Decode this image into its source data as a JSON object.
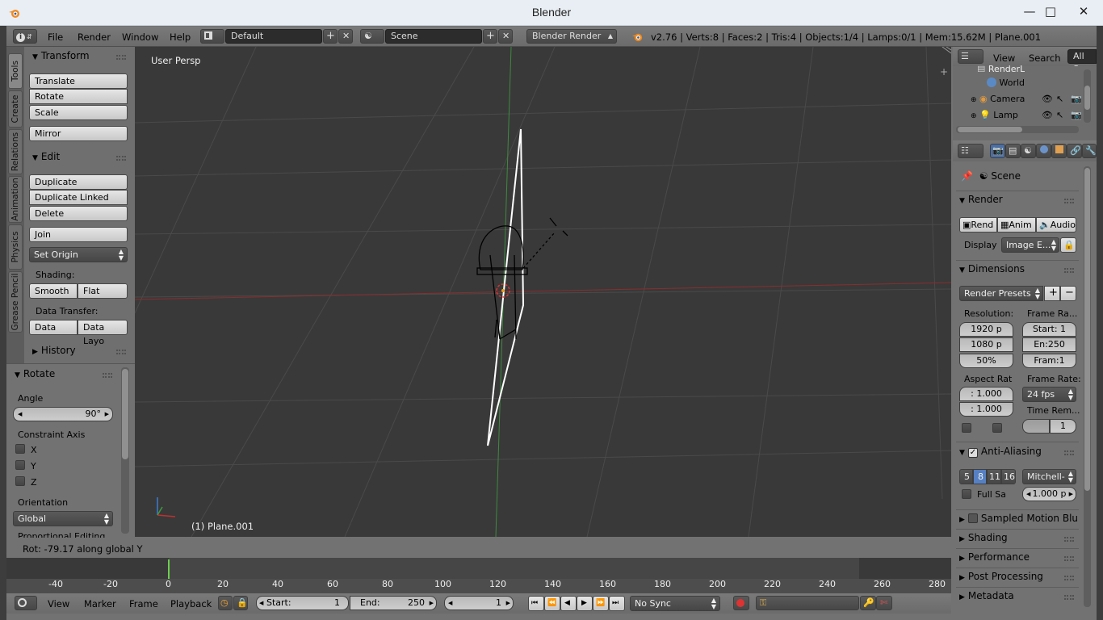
{
  "window": {
    "title": "Blender"
  },
  "info_header": {
    "menus": [
      "File",
      "Render",
      "Window",
      "Help"
    ],
    "layout": "Default",
    "scene": "Scene",
    "engine": "Blender Render",
    "stats": "v2.76 | Verts:8 | Faces:2 | Tris:4 | Objects:1/4 | Lamps:0/1 | Mem:15.62M | Plane.001"
  },
  "shelf": {
    "tabs": [
      "Tools",
      "Create",
      "Relations",
      "Animation",
      "Physics",
      "Grease Pencil"
    ],
    "transform": {
      "title": "Transform",
      "translate": "Translate",
      "rotate": "Rotate",
      "scale": "Scale",
      "mirror": "Mirror"
    },
    "edit": {
      "title": "Edit",
      "duplicate": "Duplicate",
      "duplicate_linked": "Duplicate Linked",
      "delete": "Delete",
      "join": "Join",
      "set_origin": "Set Origin",
      "shading_label": "Shading:",
      "smooth": "Smooth",
      "flat": "Flat",
      "data_transfer_label": "Data Transfer:",
      "data": "Data",
      "data_layo": "Data Layo"
    },
    "history": {
      "title": "History"
    }
  },
  "redo": {
    "title": "Rotate",
    "angle_label": "Angle",
    "angle": "90°",
    "constraint_label": "Constraint Axis",
    "axes": [
      "X",
      "Y",
      "Z"
    ],
    "orientation_label": "Orientation",
    "orientation": "Global",
    "proportional": "Proportional Editing"
  },
  "viewport": {
    "view_name": "User Persp",
    "object_label": "(1) Plane.001"
  },
  "status": {
    "text": "Rot: -79.17 along global Y"
  },
  "timeline": {
    "ticks": [
      "-40",
      "-20",
      "0",
      "20",
      "40",
      "60",
      "80",
      "100",
      "120",
      "140",
      "160",
      "180",
      "200",
      "220",
      "240",
      "260",
      "280"
    ],
    "menus": [
      "View",
      "Marker",
      "Frame",
      "Playback"
    ],
    "start_label": "Start:",
    "start": "1",
    "end_label": "End:",
    "end": "250",
    "current": "1",
    "sync": "No Sync"
  },
  "outliner": {
    "menus": [
      "View",
      "Search"
    ],
    "filter": "All Sc",
    "items": [
      "RenderL",
      "World",
      "Camera",
      "Lamp"
    ]
  },
  "properties": {
    "scene": "Scene",
    "render": {
      "title": "Render",
      "rend": "Rend",
      "anim": "Anim",
      "audio": "Audio",
      "display_label": "Display",
      "display": "Image E..."
    },
    "dimensions": {
      "title": "Dimensions",
      "presets": "Render Presets",
      "resolution_label": "Resolution:",
      "res_x": "1920 p",
      "res_y": "1080 p",
      "res_pct": "50%",
      "frame_range_label": "Frame Ra...",
      "start": "Start: 1",
      "end": "En:250",
      "frame": "Fram:1",
      "aspect_label": "Aspect Rat",
      "aspect_x": ": 1.000",
      "aspect_y": ": 1.000",
      "frame_rate_label": "Frame Rate:",
      "fps": "24 fps",
      "time_rem_label": "Time Rem...",
      "time_val": "1"
    },
    "anti_aliasing": {
      "title": "Anti-Aliasing",
      "samples": [
        "5",
        "8",
        "11",
        "16"
      ],
      "filter": "Mitchell-",
      "full_sample": "Full Sa",
      "size": "1.000 p"
    },
    "collapsed": [
      "Sampled Motion Blur",
      "Shading",
      "Performance",
      "Post Processing",
      "Metadata"
    ]
  },
  "colors": {
    "accent_blue": "#5680c2",
    "viewport_bg": "#393939",
    "panel_bg": "#727272"
  }
}
